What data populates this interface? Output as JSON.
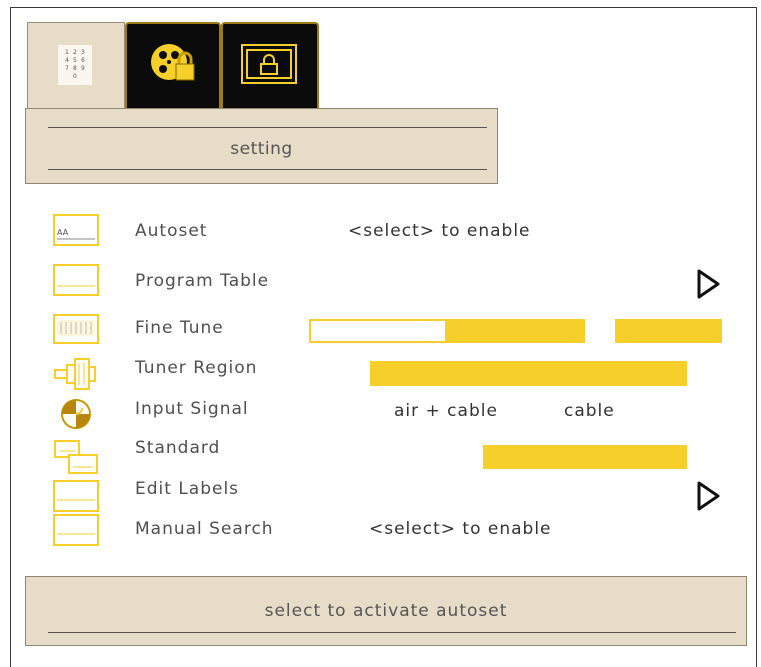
{
  "tabs": [
    {
      "icon": "keypad-icon",
      "active": true
    },
    {
      "icon": "film-reel-lock-icon",
      "active": false
    },
    {
      "icon": "screen-lock-icon",
      "active": false
    }
  ],
  "header": {
    "title": "setting"
  },
  "menu": {
    "autoset": {
      "label": "Autoset",
      "hint": "<select>  to enable"
    },
    "program_table": {
      "label": "Program Table"
    },
    "fine_tune": {
      "label": "Fine Tune",
      "level": 0.29
    },
    "tuner_region": {
      "label": "Tuner Region"
    },
    "input_signal": {
      "label": "Input Signal",
      "option_1": "air + cable",
      "option_2": "cable"
    },
    "standard": {
      "label": "Standard"
    },
    "edit_labels": {
      "label": "Edit Labels"
    },
    "manual_search": {
      "label": "Manual Search",
      "hint": "<select>  to enable"
    }
  },
  "footer": {
    "status": "select to activate autoset"
  },
  "colors": {
    "accent": "#f6cf2b",
    "panel": "#e7dcc7",
    "tab_dark": "#0b0b0b"
  }
}
